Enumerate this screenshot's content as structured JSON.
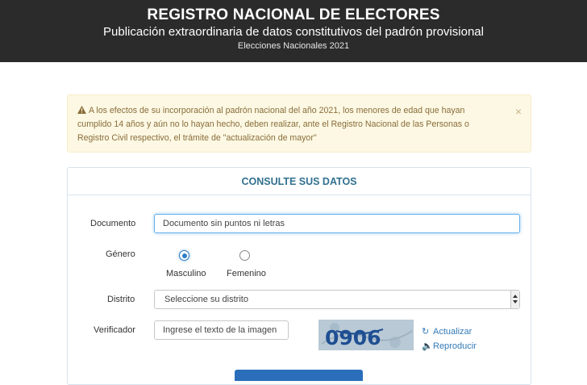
{
  "header": {
    "title": "REGISTRO NACIONAL DE ELECTORES",
    "subtitle": "Publicación extraordinaria de datos constitutivos del padrón provisional",
    "meta": "Elecciones Nacionales 2021"
  },
  "alert": {
    "icon": "warning-icon",
    "text": "A los efectos de su incorporación al padrón nacional del año 2021, los menores de edad que hayan cumplido 14 años y aún no lo hayan hecho, deben realizar, ante el Registro Nacional de las Personas o Registro Civil respectivo, el trámite de \"actualización de mayor\"",
    "close": "×"
  },
  "form": {
    "heading": "CONSULTE SUS DATOS",
    "documento": {
      "label": "Documento",
      "placeholder": "Documento sin puntos ni letras"
    },
    "genero": {
      "label": "Género",
      "options": [
        "Masculino",
        "Femenino"
      ],
      "selected": "Masculino"
    },
    "distrito": {
      "label": "Distrito",
      "value": "Seleccione su distrito"
    },
    "verificador": {
      "label": "Verificador",
      "placeholder": "Ingrese el texto de la imagen",
      "captcha_text": "0906",
      "refresh": "Actualizar",
      "play": "Reproducir"
    }
  },
  "colors": {
    "header_bg": "#2b2b2b",
    "alert_bg": "#fcf8e3",
    "alert_text": "#8a6d3b",
    "panel_heading": "#31708f",
    "link": "#337ab7",
    "primary": "#2a6ebb"
  }
}
